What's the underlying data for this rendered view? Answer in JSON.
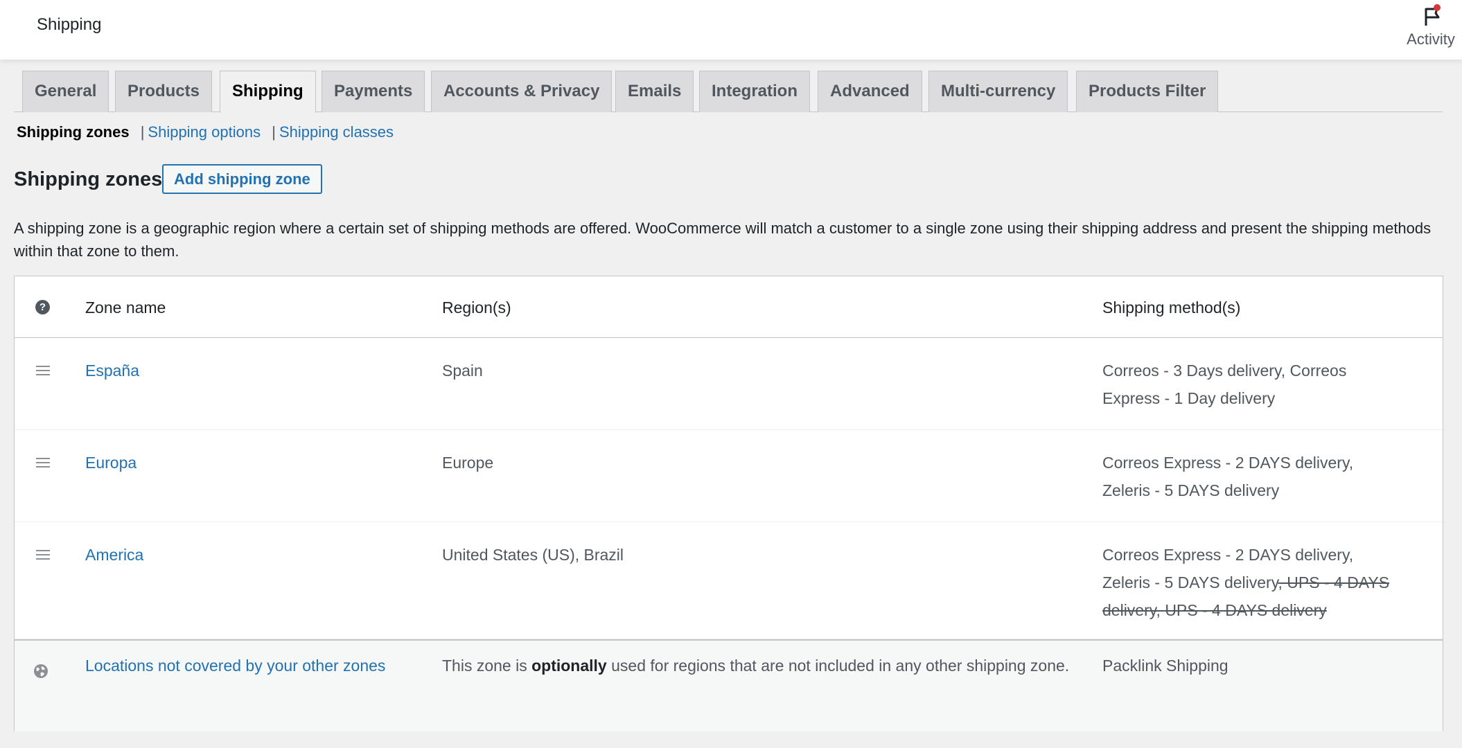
{
  "header": {
    "title": "Shipping",
    "activity_label": "Activity"
  },
  "tabs": [
    {
      "label": "General"
    },
    {
      "label": "Products"
    },
    {
      "label": "Shipping"
    },
    {
      "label": "Payments"
    },
    {
      "label": "Accounts & Privacy"
    },
    {
      "label": "Emails"
    },
    {
      "label": "Integration"
    },
    {
      "label": "Advanced"
    },
    {
      "label": "Multi-currency"
    },
    {
      "label": "Products Filter"
    }
  ],
  "active_tab": "Shipping",
  "subnav": {
    "current": "Shipping zones",
    "separator": "|",
    "options": "Shipping options",
    "classes": "Shipping classes"
  },
  "page": {
    "heading": "Shipping zones",
    "add_button": "Add shipping zone",
    "description": "A shipping zone is a geographic region where a certain set of shipping methods are offered. WooCommerce will match a customer to a single zone using their shipping address and present the shipping methods within that zone to them."
  },
  "table": {
    "headers": {
      "help": "?",
      "zone_name": "Zone name",
      "regions": "Region(s)",
      "methods": "Shipping method(s)"
    },
    "rows": [
      {
        "name": "España",
        "region": "Spain",
        "methods": "Correos - 3 Days delivery, Correos Express - 1 Day delivery",
        "disabled_methods": ""
      },
      {
        "name": "Europa",
        "region": "Europe",
        "methods": "Correos Express - 2 DAYS delivery, Zeleris - 5 DAYS delivery",
        "disabled_methods": ""
      },
      {
        "name": "America",
        "region": "United States (US), Brazil",
        "methods": "Correos Express - 2 DAYS delivery, Zeleris - 5 DAYS delivery",
        "disabled_methods": ", UPS - 4 DAYS delivery, UPS - 4 DAYS delivery"
      }
    ],
    "rest": {
      "name": "Locations not covered by your other zones",
      "desc_before": "This zone is ",
      "desc_bold": "optionally",
      "desc_after": " used for regions that are not included in any other shipping zone.",
      "methods": "Packlink Shipping"
    }
  },
  "colors": {
    "link": "#2271b1",
    "notification_dot": "#d63638"
  }
}
